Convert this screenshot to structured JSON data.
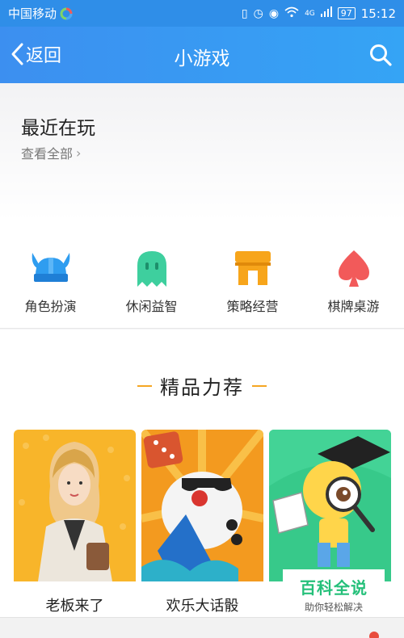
{
  "status_bar": {
    "carrier": "中国移动",
    "network": "4G",
    "battery": "97",
    "time": "15:12",
    "icons": [
      "vibrate-icon",
      "alarm-icon",
      "eye-comfort-icon",
      "wifi-icon",
      "signal-icon",
      "battery-icon"
    ]
  },
  "nav": {
    "back_label": "返回",
    "title": "小游戏",
    "search_icon": "search-icon"
  },
  "recent": {
    "title": "最近在玩",
    "see_all": "查看全部"
  },
  "categories": [
    {
      "label": "角色扮演",
      "icon": "viking-helmet-icon",
      "color": "#2f9df0"
    },
    {
      "label": "休闲益智",
      "icon": "ghost-icon",
      "color": "#3ecf9e"
    },
    {
      "label": "策略经营",
      "icon": "shop-icon",
      "color": "#f7a51b"
    },
    {
      "label": "棋牌桌游",
      "icon": "spade-icon",
      "color": "#f25a5a"
    }
  ],
  "featured": {
    "title": "精品力荐",
    "accent_color": "#f5a623",
    "games": [
      {
        "name": "老板来了",
        "bg": "#f8b52a"
      },
      {
        "name": "欢乐大话骰",
        "bg": "#f39a1f"
      },
      {
        "name": "",
        "bg": "#37c98a"
      }
    ]
  },
  "watermark": {
    "title": "百科全说",
    "subtitle": "助你轻松解决"
  }
}
